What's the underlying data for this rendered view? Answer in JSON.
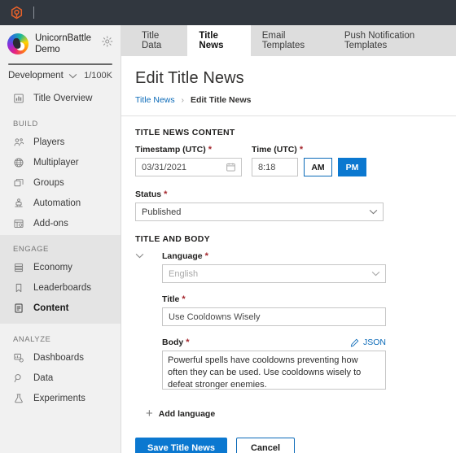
{
  "topbar": {
    "logo_icon": "playfab-logo-icon"
  },
  "sidebar": {
    "app_title": "UnicornBattle Demo",
    "settings_icon": "gear-icon",
    "env_name": "Development",
    "env_chevron_icon": "chevron-down-icon",
    "env_quota": "1/100K",
    "overview": {
      "label": "Title Overview",
      "icon": "chart-bar-icon"
    },
    "sections": [
      {
        "title": "BUILD",
        "items": [
          {
            "label": "Players",
            "icon": "people-icon"
          },
          {
            "label": "Multiplayer",
            "icon": "globe-icon"
          },
          {
            "label": "Groups",
            "icon": "stack-icon"
          },
          {
            "label": "Automation",
            "icon": "robot-icon"
          },
          {
            "label": "Add-ons",
            "icon": "addons-icon"
          }
        ]
      },
      {
        "title": "ENGAGE",
        "items": [
          {
            "label": "Economy",
            "icon": "database-icon"
          },
          {
            "label": "Leaderboards",
            "icon": "bookmark-icon"
          },
          {
            "label": "Content",
            "icon": "document-icon"
          }
        ]
      },
      {
        "title": "ANALYZE",
        "items": [
          {
            "label": "Dashboards",
            "icon": "dashboard-icon"
          },
          {
            "label": "Data",
            "icon": "magnifier-icon"
          },
          {
            "label": "Experiments",
            "icon": "flask-icon"
          }
        ]
      }
    ]
  },
  "tabs": [
    {
      "label": "Title Data"
    },
    {
      "label": "Title News"
    },
    {
      "label": "Email Templates"
    },
    {
      "label": "Push Notification Templates"
    }
  ],
  "page": {
    "title": "Edit Title News",
    "breadcrumb_parent": "Title News",
    "breadcrumb_sep": "›",
    "breadcrumb_current": "Edit Title News"
  },
  "form": {
    "content_section": "TITLE NEWS CONTENT",
    "timestamp_label": "Timestamp (UTC)",
    "timestamp_value": "03/31/2021",
    "calendar_icon": "calendar-icon",
    "time_label": "Time (UTC)",
    "time_value": "8:18",
    "am_label": "AM",
    "pm_label": "PM",
    "status_label": "Status",
    "status_value": "Published",
    "status_options": [
      "Published"
    ],
    "body_section": "TITLE AND BODY",
    "language_label": "Language",
    "language_value": "English",
    "language_options": [
      "English"
    ],
    "collapse_icon": "chevron-down-icon",
    "title_label": "Title",
    "title_value": "Use Cooldowns Wisely",
    "body_label": "Body",
    "json_link_label": "JSON",
    "json_icon": "pencil-icon",
    "body_value": "Powerful spells have cooldowns preventing how often they can be used. Use cooldowns wisely to defeat stronger enemies.",
    "add_language_label": "Add language",
    "required_marker": "*",
    "save_label": "Save Title News",
    "cancel_label": "Cancel"
  },
  "colors": {
    "topbar": "#31373f",
    "accent_blue": "#0b78d0",
    "link_blue": "#0b6ab8",
    "required_red": "#a4262c",
    "sidebar_bg": "#f1f1f1",
    "tabstrip_bg": "#dddddd",
    "logo_orange": "#e8622a"
  }
}
